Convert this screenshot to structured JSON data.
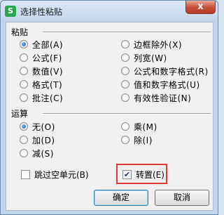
{
  "window": {
    "title": "选择性粘贴",
    "app_icon": "S",
    "close_label": "x"
  },
  "paste": {
    "heading": "粘贴",
    "left": [
      {
        "label": "全部(A)",
        "checked": true
      },
      {
        "label": "公式(F)",
        "checked": false
      },
      {
        "label": "数值(V)",
        "checked": false
      },
      {
        "label": "格式(T)",
        "checked": false
      },
      {
        "label": "批注(C)",
        "checked": false
      }
    ],
    "right": [
      {
        "label": "边框除外(X)",
        "checked": false
      },
      {
        "label": "列宽(W)",
        "checked": false
      },
      {
        "label": "公式和数字格式(R)",
        "checked": false
      },
      {
        "label": "值和数字格式(U)",
        "checked": false
      },
      {
        "label": "有效性验证(N)",
        "checked": false
      }
    ]
  },
  "operation": {
    "heading": "运算",
    "left": [
      {
        "label": "无(O)",
        "checked": true
      },
      {
        "label": "加(D)",
        "checked": false
      },
      {
        "label": "减(S)",
        "checked": false
      }
    ],
    "right": [
      {
        "label": "乘(M)",
        "checked": false
      },
      {
        "label": "除(I)",
        "checked": false
      }
    ]
  },
  "options": {
    "skip_blanks": {
      "label": "跳过空单元(B)",
      "checked": false
    },
    "transpose": {
      "label": "转置(E)",
      "checked": true,
      "check_glyph": "✔"
    }
  },
  "buttons": {
    "ok": "确定",
    "cancel": "取消"
  },
  "colors": {
    "highlight": "#e03a3a",
    "selected_radio": "#1d63b8"
  }
}
